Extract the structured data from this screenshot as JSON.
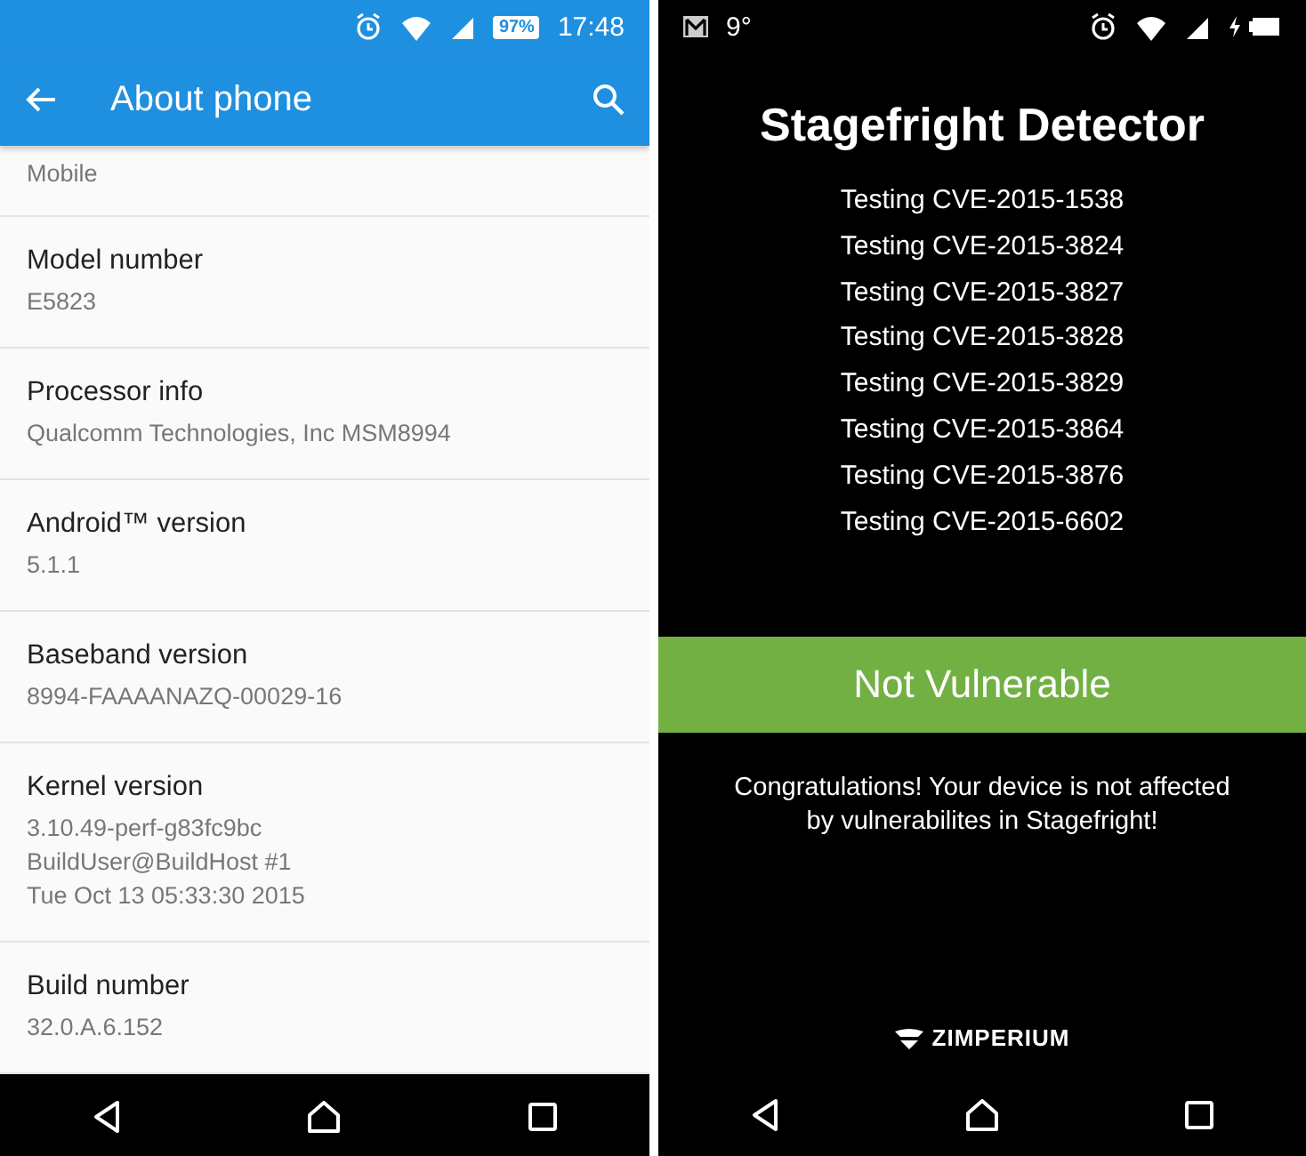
{
  "left_phone": {
    "status_bar": {
      "battery": "97%",
      "time": "17:48"
    },
    "app_bar": {
      "title": "About phone"
    },
    "items": [
      {
        "value": "Mobile"
      },
      {
        "title": "Model number",
        "value": "E5823"
      },
      {
        "title": "Processor info",
        "value": "Qualcomm Technologies, Inc MSM8994"
      },
      {
        "title": "Android™ version",
        "value": "5.1.1"
      },
      {
        "title": "Baseband version",
        "value": "8994-FAAAANAZQ-00029-16"
      },
      {
        "title": "Kernel version",
        "value": "3.10.49-perf-g83fc9bc\nBuildUser@BuildHost #1\nTue Oct 13 05:33:30 2015"
      },
      {
        "title": "Build number",
        "value": "32.0.A.6.152"
      }
    ]
  },
  "right_phone": {
    "status_bar": {
      "temperature": "9°"
    },
    "title": "Stagefright Detector",
    "tests": [
      "Testing CVE-2015-1538",
      "Testing CVE-2015-3824",
      "Testing CVE-2015-3827",
      "Testing CVE-2015-3828",
      "Testing CVE-2015-3829",
      "Testing CVE-2015-3864",
      "Testing CVE-2015-3876",
      "Testing CVE-2015-6602"
    ],
    "result": "Not Vulnerable",
    "message": "Congratulations! Your device is not affected by vulnerabilites in Stagefright!",
    "brand": "ZIMPERIUM"
  }
}
